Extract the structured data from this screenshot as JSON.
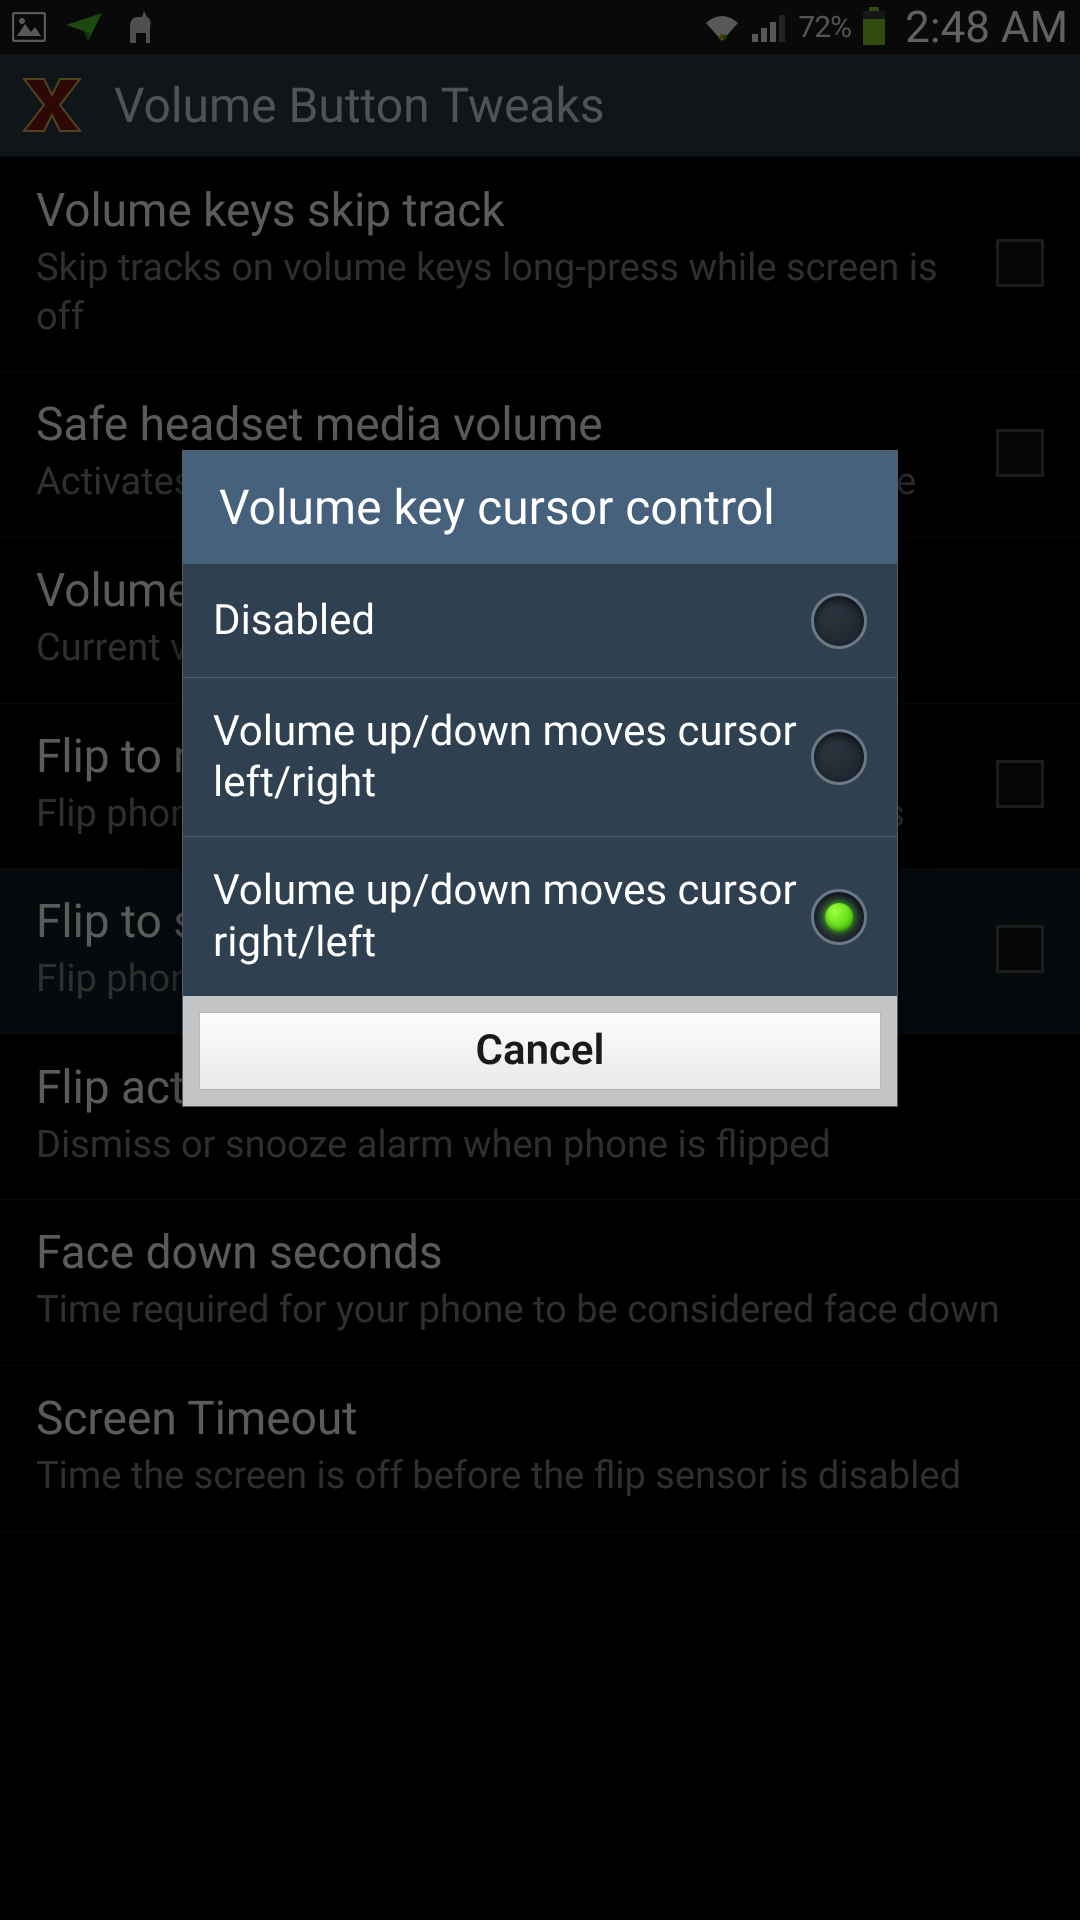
{
  "status": {
    "battery_pct": "72%",
    "time": "2:48 AM"
  },
  "actionbar": {
    "title": "Volume Button Tweaks"
  },
  "settings": [
    {
      "title": "Volume keys skip track",
      "sub": "Skip tracks on volume keys long-press while screen is off",
      "checkbox": true
    },
    {
      "title": "Safe headset media volume",
      "sub": "Activates or deactivates safe headset media volume",
      "checkbox": true
    },
    {
      "title": "Volume key cursor control",
      "sub": "Current value",
      "checkbox": false
    },
    {
      "title": "Flip to mute",
      "sub": "Flip phone face down to mute incoming phone calls",
      "checkbox": true
    },
    {
      "title": "Flip to snooze",
      "sub": "Flip phone face down to snooze",
      "checkbox": true
    },
    {
      "title": "Flip action",
      "sub": "Dismiss or snooze alarm when phone is flipped",
      "checkbox": false
    },
    {
      "title": "Face down seconds",
      "sub": "Time required for your phone to be considered face down",
      "checkbox": false
    },
    {
      "title": "Screen Timeout",
      "sub": "Time the screen is off before the flip sensor is disabled",
      "checkbox": false
    }
  ],
  "dialog": {
    "title": "Volume key cursor control",
    "options": [
      {
        "label": "Disabled",
        "checked": false
      },
      {
        "label": "Volume up/down moves cursor left/right",
        "checked": false
      },
      {
        "label": "Volume up/down moves cursor right/left",
        "checked": true
      }
    ],
    "cancel_label": "Cancel"
  }
}
